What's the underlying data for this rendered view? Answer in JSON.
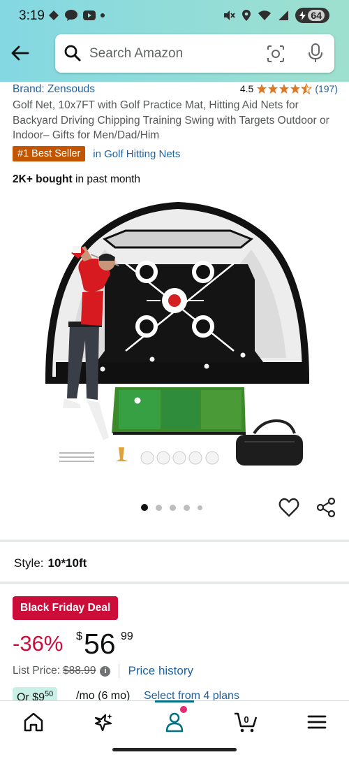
{
  "status_bar": {
    "time": "3:19",
    "battery": "64",
    "icons": [
      "photos-icon",
      "talk-icon",
      "youtube-icon",
      "notification-dot",
      "mute-icon",
      "location-icon",
      "wifi-icon",
      "signal-icon",
      "battery-icon"
    ]
  },
  "header": {
    "back_icon": "back-arrow-icon",
    "search_placeholder": "Search Amazon",
    "camera_icon": "camera-search-icon",
    "mic_icon": "microphone-icon",
    "background_gradient": [
      "#84d8e2",
      "#9ee0cf"
    ]
  },
  "product": {
    "brand": "Brand: Zensouds",
    "rating": "4.5",
    "rating_value": 4.5,
    "review_count": "(197)",
    "title": "Golf Net, 10x7FT with Golf Practice Mat, Hitting Aid Nets for Backyard Driving Chipping Training Swing with Targets Outdoor or Indoor– Gifts for Men/Dad/Him",
    "best_seller_badge": "#1 Best Seller",
    "best_seller_category": "in Golf Hitting Nets",
    "bought_bold": "2K+ bought",
    "bought_rest": " in past month"
  },
  "gallery": {
    "image_count": 5,
    "active_index": 0,
    "heart_icon": "heart-outline-icon",
    "share_icon": "share-icon"
  },
  "style_selector": {
    "label": "Style:",
    "value": "10*10ft"
  },
  "pricing": {
    "deal_badge": "Black Friday Deal",
    "discount": "-36%",
    "currency": "$",
    "price_whole": "56",
    "price_fraction": "99",
    "list_price_label": "List Price:",
    "list_price": "$88.99",
    "price_history": "Price history",
    "plan_prefix": "Or $9",
    "plan_cents": "50",
    "plan_term": "/mo (6 mo)",
    "plan_link": "Select from 4 plans"
  },
  "bottom_nav": {
    "items": [
      "home-icon",
      "rufus-sparkle-icon",
      "account-icon",
      "cart-icon",
      "menu-icon"
    ],
    "cart_count": "0",
    "active": "account-icon"
  },
  "colors": {
    "link": "#2162a1",
    "deal_red": "#cc0c39",
    "best_seller_orange": "#c45500",
    "star_orange": "#de7921"
  }
}
